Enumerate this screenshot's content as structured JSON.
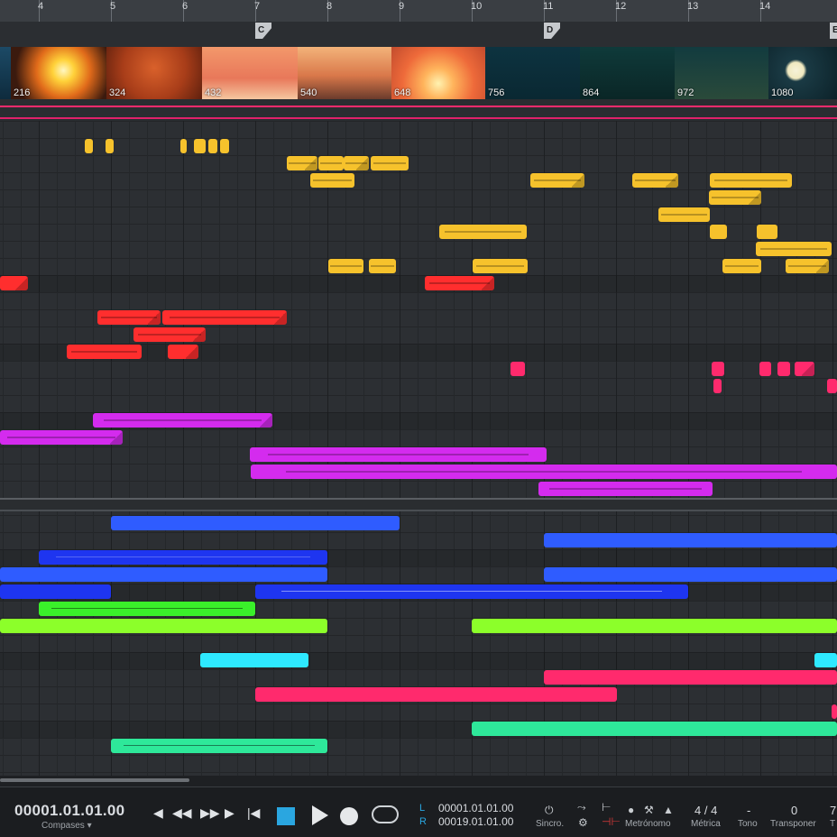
{
  "ruler": {
    "bars": [
      "4",
      "5",
      "6",
      "7",
      "8",
      "9",
      "10",
      "11",
      "12",
      "13",
      "14"
    ]
  },
  "markers": [
    "C",
    "D",
    "E"
  ],
  "video": {
    "frames": [
      "216",
      "324",
      "432",
      "540",
      "648",
      "756",
      "864",
      "972",
      "1080"
    ]
  },
  "colors": {
    "yellow": "#f6c22c",
    "red": "#ff2e2e",
    "pink": "#ff2a6d",
    "magenta": "#d42bee",
    "blue": "#2c5cff",
    "blue2": "#3366ff",
    "darkblue": "#1e35f0",
    "green": "#3af02a",
    "lime": "#8cff2a",
    "cyan": "#2ee9ff",
    "teal": "#2ee89a"
  },
  "transport": {
    "timecode": "00001.01.01.00",
    "timecode_format": "Compases",
    "loop_left_label": "L",
    "loop_right_label": "R",
    "loop_start": "00001.01.01.00",
    "loop_end": "00019.01.01.00",
    "sync_label": "Sincro.",
    "metronome_label": "Metrónomo",
    "meter_value": "4 / 4",
    "meter_label": "Métrica",
    "key_value": "-",
    "key_label": "Tono",
    "transpose_value": "0",
    "transpose_label": "Transponer",
    "tempo_value": "7",
    "tempo_label": "T"
  }
}
